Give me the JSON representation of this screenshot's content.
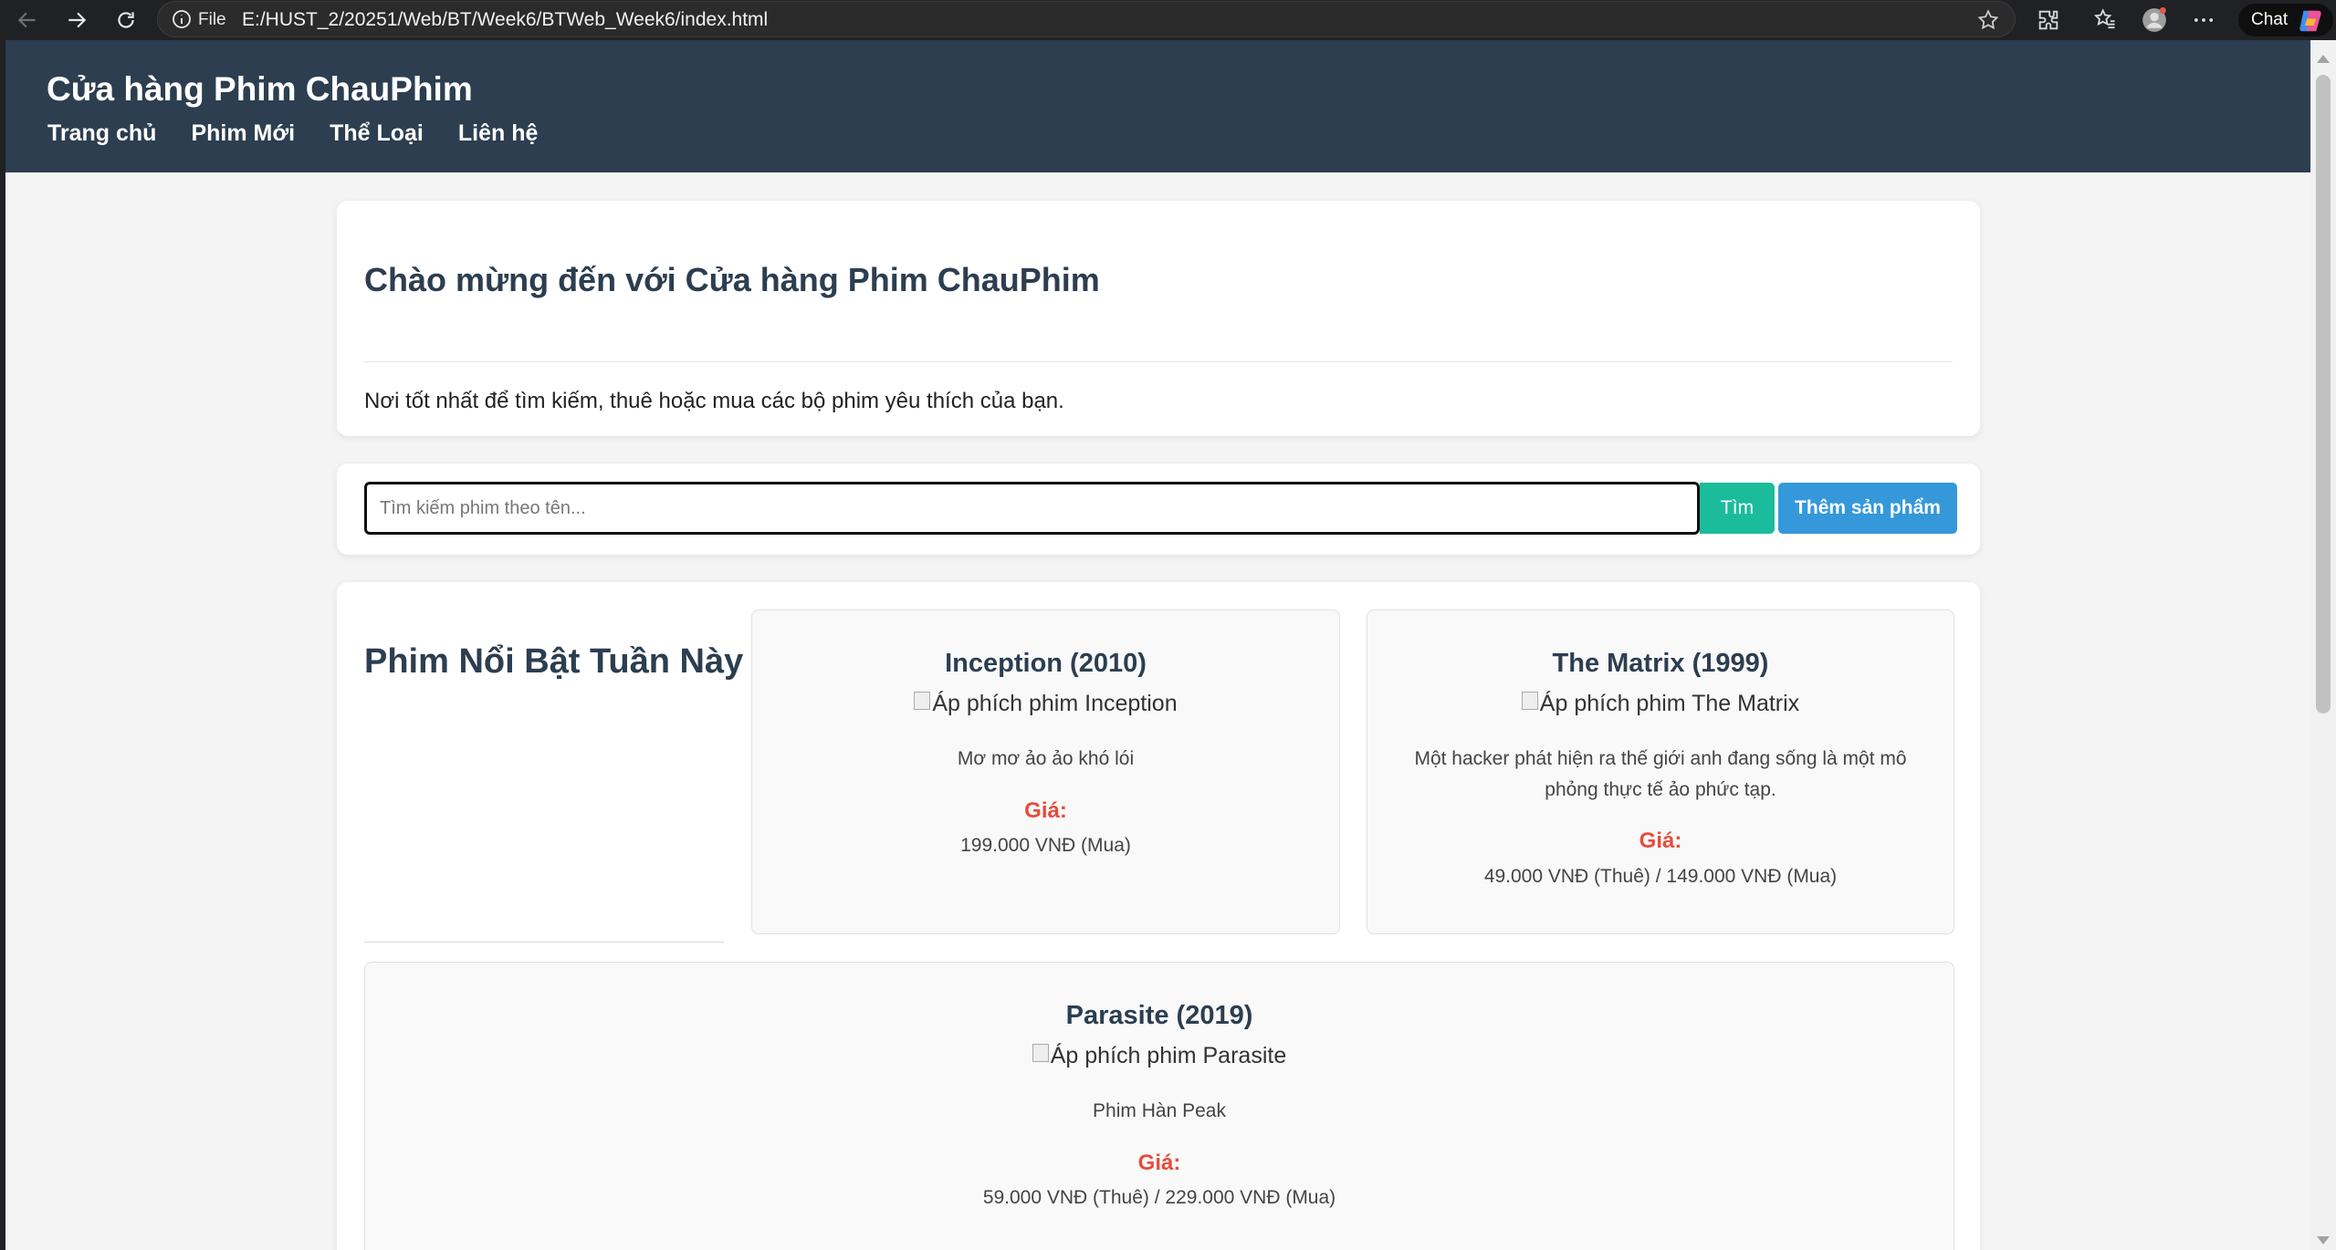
{
  "browser": {
    "file_label": "File",
    "url": "E:/HUST_2/20251/Web/BT/Week6/BTWeb_Week6/index.html",
    "chat_label": "Chat"
  },
  "site": {
    "title": "Cửa hàng Phim ChauPhim",
    "nav": [
      "Trang chủ",
      "Phim Mới",
      "Thể Loại",
      "Liên hệ"
    ]
  },
  "welcome": {
    "heading": "Chào mừng đến với Cửa hàng Phim ChauPhim",
    "text": "Nơi tốt nhất để tìm kiếm, thuê hoặc mua các bộ phim yêu thích của bạn."
  },
  "search": {
    "placeholder": "Tìm kiếm phim theo tên...",
    "value": "",
    "search_label": "Tìm",
    "add_label": "Thêm sản phẩm"
  },
  "featured": {
    "heading": "Phim Nổi Bật Tuần Này",
    "movies": [
      {
        "title": "Inception (2010)",
        "poster_alt": "Áp phích phim Inception",
        "description": "Mơ mơ ảo ảo khó lói",
        "price_label": "Giá:",
        "price": "199.000 VNĐ (Mua)"
      },
      {
        "title": "The Matrix (1999)",
        "poster_alt": "Áp phích phim The Matrix",
        "description": "Một hacker phát hiện ra thế giới anh đang sống là một mô phỏng thực tế ảo phức tạp.",
        "price_label": "Giá:",
        "price": "49.000 VNĐ (Thuê) / 149.000 VNĐ (Mua)"
      },
      {
        "title": "Parasite (2019)",
        "poster_alt": "Áp phích phim Parasite",
        "description": "Phim Hàn Peak",
        "price_label": "Giá:",
        "price": "59.000 VNĐ (Thuê) / 229.000 VNĐ (Mua)"
      }
    ]
  },
  "colors": {
    "header_bg": "#2c3e50",
    "search_button": "#1abc9c",
    "add_button": "#3498db",
    "price_label": "#e74c3c"
  }
}
